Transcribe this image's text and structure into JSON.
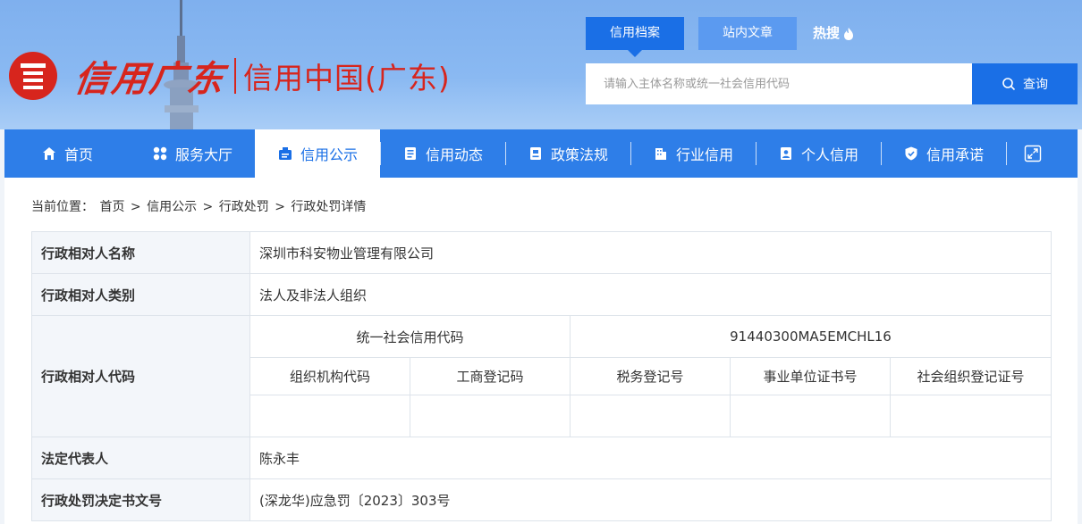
{
  "header": {
    "logo_script": "信用广东",
    "logo_name": "信用中国(广东)",
    "top_tabs": [
      "信用档案",
      "站内文章",
      "热搜"
    ],
    "search_placeholder": "请输入主体名称或统一社会信用代码",
    "search_button": "查询"
  },
  "nav": {
    "items": [
      {
        "label": "首页",
        "icon": "home-icon"
      },
      {
        "label": "服务大厅",
        "icon": "grid-icon"
      },
      {
        "label": "信用公示",
        "icon": "announce-icon"
      },
      {
        "label": "信用动态",
        "icon": "news-icon"
      },
      {
        "label": "政策法规",
        "icon": "policy-icon"
      },
      {
        "label": "行业信用",
        "icon": "building-icon"
      },
      {
        "label": "个人信用",
        "icon": "id-card-icon"
      },
      {
        "label": "信用承诺",
        "icon": "shield-icon"
      }
    ],
    "active_index": 2
  },
  "breadcrumb": {
    "prefix": "当前位置：",
    "items": [
      "首页",
      "信用公示",
      "行政处罚",
      "行政处罚详情"
    ],
    "separator": ">"
  },
  "detail": {
    "name_label": "行政相对人名称",
    "name_value": "深圳市科安物业管理有限公司",
    "type_label": "行政相对人类别",
    "type_value": "法人及非法人组织",
    "code_label": "行政相对人代码",
    "uscc_label": "统一社会信用代码",
    "uscc_value": "91440300MA5EMCHL16",
    "sub_codes": [
      "组织机构代码",
      "工商登记码",
      "税务登记号",
      "事业单位证书号",
      "社会组织登记证号"
    ],
    "legal_rep_label": "法定代表人",
    "legal_rep_value": "陈永丰",
    "decision_label": "行政处罚决定书文号",
    "decision_value": "(深龙华)应急罚〔2023〕303号"
  }
}
